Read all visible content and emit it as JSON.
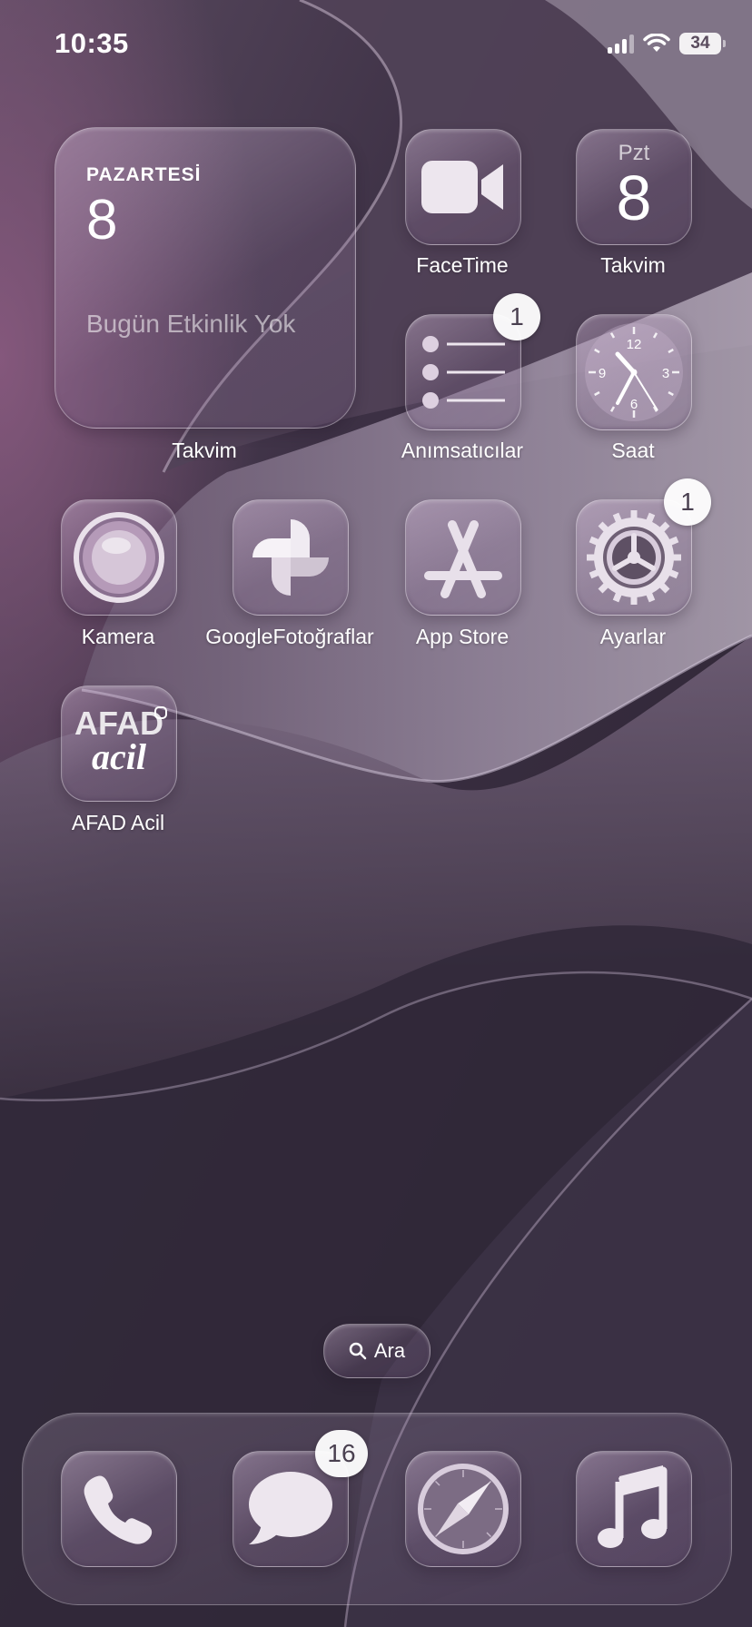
{
  "status_bar": {
    "time": "10:35",
    "battery_level": "34",
    "cellular_signal_bars": 3,
    "wifi_icon": "wifi-icon"
  },
  "calendar_widget": {
    "day_name": "PAZARTESİ",
    "date": "8",
    "no_events_text": "Bugün Etkinlik Yok",
    "label": "Takvim"
  },
  "apps": {
    "facetime": {
      "label": "FaceTime",
      "icon": "video-camera-icon"
    },
    "calendar": {
      "label": "Takvim",
      "icon_day": "Pzt",
      "icon_date": "8"
    },
    "reminders": {
      "label": "Anımsatıcılar",
      "badge": "1",
      "icon": "list-icon"
    },
    "clock": {
      "label": "Saat",
      "icon": "clock-icon",
      "numerals": [
        "12",
        "3",
        "6",
        "9"
      ]
    },
    "camera": {
      "label": "Kamera",
      "icon": "camera-lens-icon"
    },
    "google_photos": {
      "label": "GoogleFotoğraflar",
      "icon": "pinwheel-icon"
    },
    "app_store": {
      "label": "App Store",
      "icon": "app-store-a-icon"
    },
    "settings": {
      "label": "Ayarlar",
      "badge": "1",
      "icon": "gear-icon"
    },
    "afad": {
      "label": "AFAD Acil",
      "logo_line1": "AFAD",
      "logo_line2": "acil"
    }
  },
  "search": {
    "label": "Ara",
    "icon": "search-icon"
  },
  "dock": {
    "phone": {
      "icon": "phone-icon"
    },
    "messages": {
      "icon": "message-bubble-icon",
      "badge": "16"
    },
    "safari": {
      "icon": "compass-icon"
    },
    "music": {
      "icon": "music-note-icon"
    }
  },
  "colors": {
    "wallpaper_base": "#3a3040",
    "wallpaper_light": "#9a8ca0",
    "badge_bg": "#ffffff",
    "badge_text": "#4a4050"
  }
}
